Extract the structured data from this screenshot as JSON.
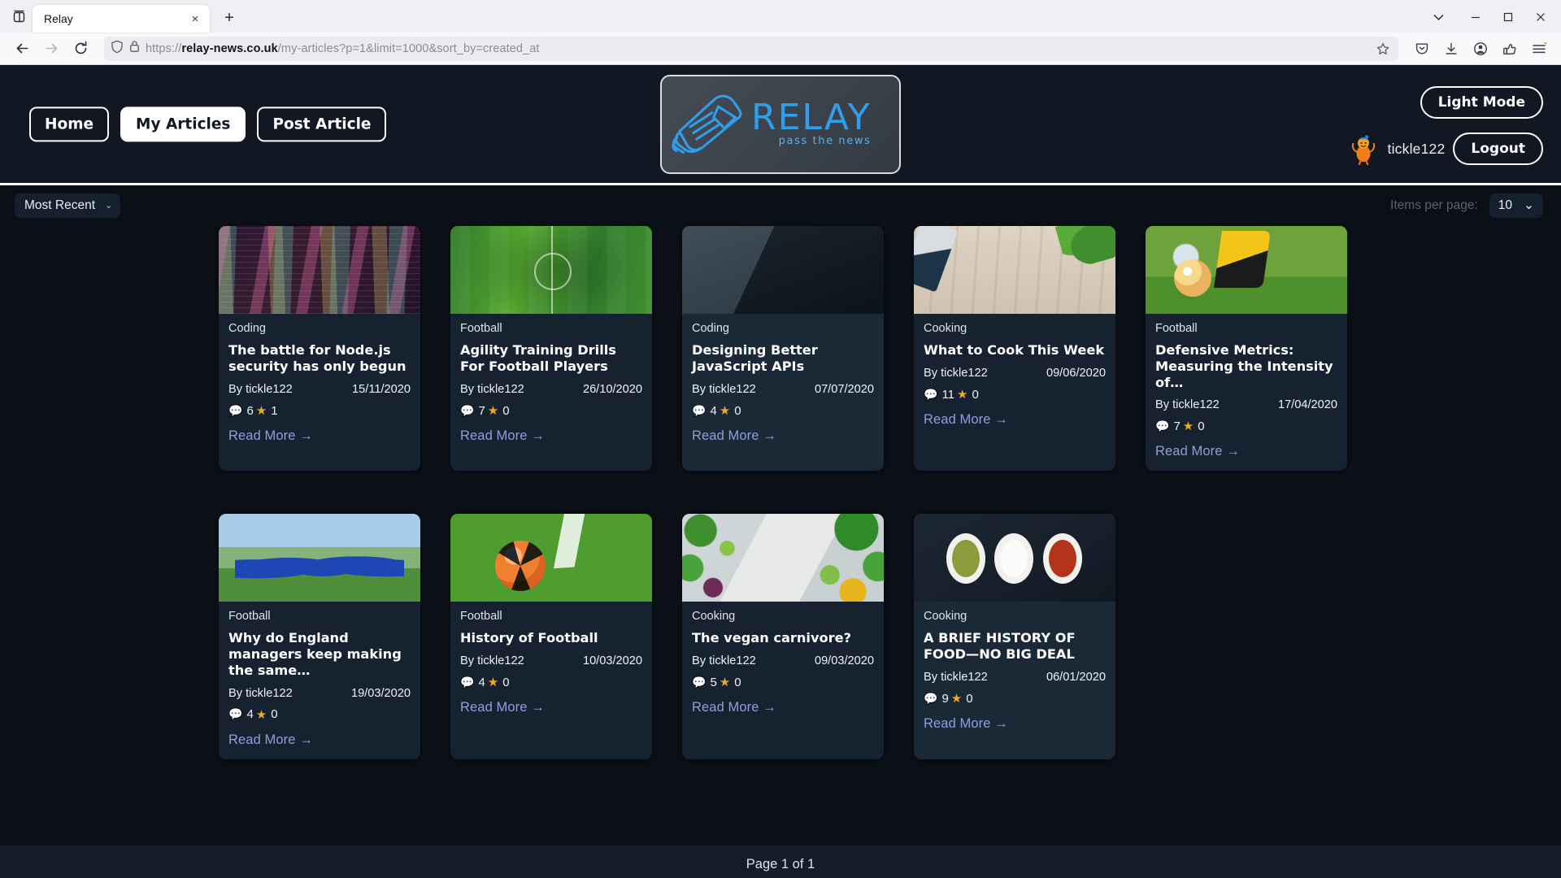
{
  "browser": {
    "tab_title": "Relay",
    "url_prefix": "https://",
    "url_domain": "relay-news.co.uk",
    "url_path": "/my-articles?p=1&limit=1000&sort_by=created_at",
    "new_tab_label": "+",
    "close_tab_label": "×",
    "minimize_label": "–",
    "maximize_label": "❐",
    "close_window_label": "×",
    "list_all_tabs_label": "⌄"
  },
  "header": {
    "logo_word": "RELAY",
    "logo_tagline": "pass the news",
    "nav": [
      {
        "label": "Home",
        "active": false
      },
      {
        "label": "My Articles",
        "active": true
      },
      {
        "label": "Post Article",
        "active": false
      }
    ],
    "theme_toggle_label": "Light Mode",
    "username": "tickle122",
    "logout_label": "Logout"
  },
  "controls": {
    "sort_value": "Most Recent",
    "items_per_page_label": "Items per page:",
    "items_per_page_value": "10",
    "chevron": "⌄"
  },
  "cards": [
    {
      "category": "Coding",
      "title": "The battle for Node.js security has only begun",
      "author": "By tickle122",
      "date": "15/11/2020",
      "comments": "6",
      "votes": "1",
      "read_more": "Read More →",
      "media": "m-code"
    },
    {
      "category": "Football",
      "title": "Agility Training Drills For Football Players",
      "author": "By tickle122",
      "date": "26/10/2020",
      "comments": "7",
      "votes": "0",
      "read_more": "Read More →",
      "media": "m-pitch"
    },
    {
      "category": "Coding",
      "title": "Designing Better JavaScript APIs",
      "author": "By tickle122",
      "date": "07/07/2020",
      "comments": "4",
      "votes": "0",
      "read_more": "Read More →",
      "media": "m-laptop"
    },
    {
      "category": "Cooking",
      "title": "What to Cook This Week",
      "author": "By tickle122",
      "date": "09/06/2020",
      "comments": "11",
      "votes": "0",
      "read_more": "Read More →",
      "media": "m-wood"
    },
    {
      "category": "Football",
      "title": "Defensive Metrics: Measuring the Intensity of…",
      "author": "By tickle122",
      "date": "17/04/2020",
      "comments": "7",
      "votes": "0",
      "read_more": "Read More →",
      "media": "m-soccer"
    },
    {
      "category": "Football",
      "title": "Why do England managers keep making the same…",
      "author": "By tickle122",
      "date": "19/03/2020",
      "comments": "4",
      "votes": "0",
      "read_more": "Read More →",
      "media": "m-team"
    },
    {
      "category": "Football",
      "title": "History of Football",
      "author": "By tickle122",
      "date": "10/03/2020",
      "comments": "4",
      "votes": "0",
      "read_more": "Read More →",
      "media": "m-ball"
    },
    {
      "category": "Cooking",
      "title": "The vegan carnivore?",
      "author": "By tickle122",
      "date": "09/03/2020",
      "comments": "5",
      "votes": "0",
      "read_more": "Read More →",
      "media": "m-veg"
    },
    {
      "category": "Cooking",
      "title": "A BRIEF HISTORY OF FOOD—NO BIG DEAL",
      "author": "By tickle122",
      "date": "06/01/2020",
      "comments": "9",
      "votes": "0",
      "read_more": "Read More →",
      "media": "m-spoons"
    }
  ],
  "footer": {
    "page_text": "Page 1 of 1"
  },
  "colors": {
    "page_bg": "#0b0f16",
    "header_bg": "#111823",
    "card_bg": "#16222f",
    "accent_link": "#8e9fdc",
    "logo_blue": "#2e9fe8",
    "star": "#f0a920",
    "avatar_orange": "#f07d1a"
  }
}
